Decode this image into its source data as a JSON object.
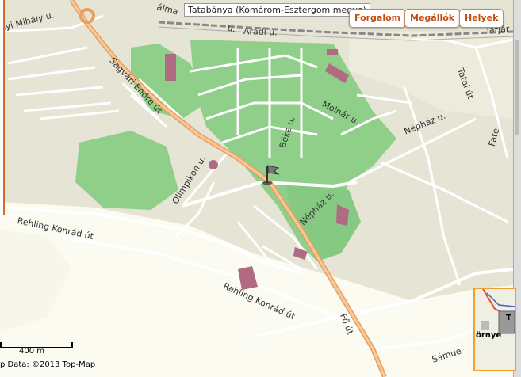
{
  "tooltip": "Tatabánya (Komárom-Esztergom megye)",
  "buttons": {
    "traffic": "Forgalom",
    "stops": "Megállók",
    "places": "Helyek"
  },
  "streets": {
    "sagvari": "Ságvári Endre út",
    "aradi": "Aradi u.",
    "molnar": "Molnár u.",
    "bekr": "Béke u.",
    "nephaz1": "Népház u.",
    "nephaz2": "Népház u.",
    "olimpikon": "Olimpikon u.",
    "rehling1": "Rehling Konrád út",
    "rehling2": "Rehling Konrád út",
    "fout": "Fő út",
    "mihaly": "lyi Mihály u.",
    "tatai": "Tatai út",
    "fater": "Fate",
    "tarjan": "Tarjár",
    "palma": "álma",
    "samuel": "Sámue",
    "ul": "u."
  },
  "scale": "400 m",
  "copyright": "p Data: ©2013 Top-Map",
  "overview": {
    "town": "örnye",
    "t": "T"
  },
  "colors": {
    "land": "#e6e4d4",
    "green": "#8fcf8a",
    "open": "#fbfbf2",
    "road": "#ffffff",
    "main_road": "#f2b47a",
    "building": "#b06a82",
    "rail": "#888888",
    "accent": "#c24e10"
  }
}
